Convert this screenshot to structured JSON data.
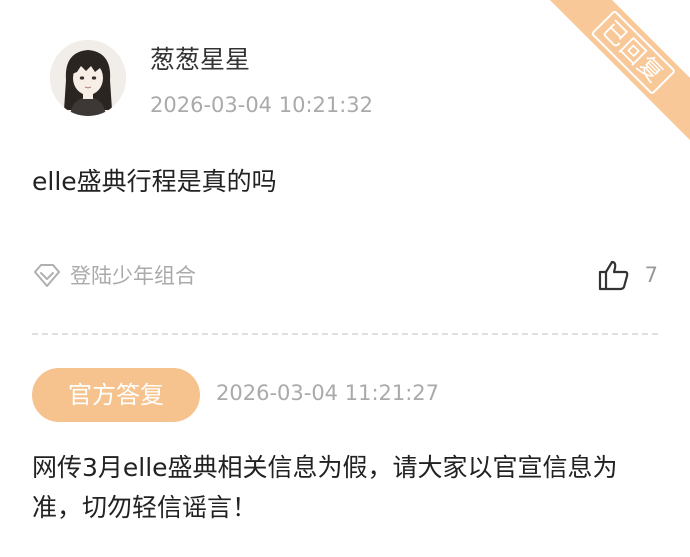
{
  "status_ribbon": "已回复",
  "post": {
    "username": "葱葱星星",
    "timestamp": "2026-03-04 10:21:32",
    "question": "elle盛典行程是真的吗",
    "topic_label": "登陆少年组合",
    "like_count": "7"
  },
  "reply": {
    "badge_label": "官方答复",
    "timestamp": "2026-03-04 11:21:27",
    "text": "网传3月elle盛典相关信息为假，请大家以官宣信息为准，切勿轻信谣言！"
  },
  "icons": {
    "topic": "diamond-icon",
    "like": "thumbs-up-icon"
  },
  "colors": {
    "accent": "#f6c38e",
    "ribbon": "#f8c898",
    "muted_text": "#aaaaaa",
    "primary_text": "#222222"
  }
}
